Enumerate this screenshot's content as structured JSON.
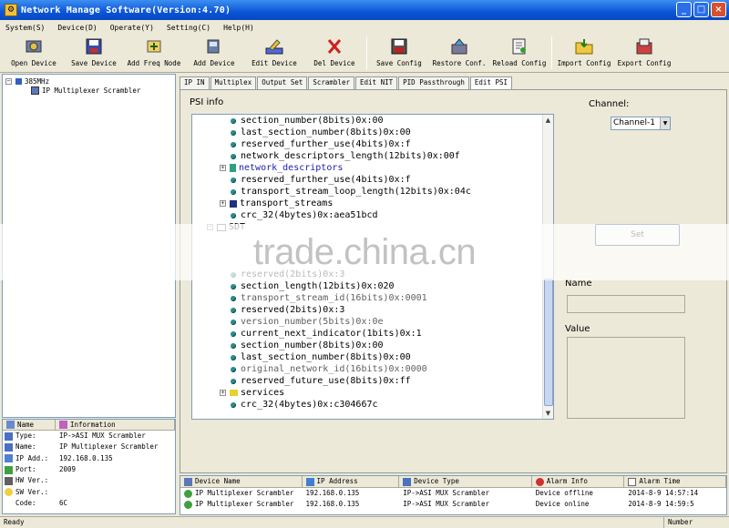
{
  "window": {
    "title": "Network Manage Software(Version:4.70)"
  },
  "menu": [
    "System(S)",
    "Device(D)",
    "Operate(Y)",
    "Setting(C)",
    "Help(H)"
  ],
  "toolbar": {
    "open_device": "Open Device",
    "save_device": "Save Device",
    "add_freq_node": "Add Freq Node",
    "add_device": "Add Device",
    "edit_device": "Edit Device",
    "del_device": "Del Device",
    "save_config": "Save Config",
    "restore_conf": "Restore Conf.",
    "reload_config": "Reload Config",
    "import_config": "Import Config",
    "export_config": "Export Config"
  },
  "left_tree": {
    "root": "385MHz",
    "child": "IP Multiplexer Scrambler"
  },
  "info": {
    "col_name": "Name",
    "col_info": "Information",
    "rows": [
      {
        "key": "Type:",
        "value": "IP->ASI MUX Scrambler"
      },
      {
        "key": "Name:",
        "value": "IP Multiplexer Scrambler"
      },
      {
        "key": "IP Add.:",
        "value": "192.168.0.135"
      },
      {
        "key": "Port:",
        "value": "2009"
      },
      {
        "key": "HW Ver.:",
        "value": ""
      },
      {
        "key": "SW Ver.:",
        "value": ""
      },
      {
        "key": "Code:",
        "value": "6C"
      }
    ]
  },
  "tabs": [
    "IP IN",
    "Multiplex",
    "Output Set",
    "Scrambler",
    "Edit NIT",
    "PID Passthrough",
    "Edit PSI"
  ],
  "psi": {
    "label": "PSI info",
    "lines": [
      "section_number(8bits)0x:00",
      "last_section_number(8bits)0x:00",
      "reserved_further_use(4bits)0x:f",
      "network_descriptors_length(12bits)0x:00f",
      "network_descriptors",
      "reserved_further_use(4bits)0x:f",
      "transport_stream_loop_length(12bits)0x:04c",
      "transport_streams",
      "crc_32(4bytes)0x:aea51bcd",
      "SDT",
      "reserved(2bits)0x:3",
      "section_length(12bits)0x:020",
      "transport_stream_id(16bits)0x:0001",
      "reserved(2bits)0x:3",
      "version_number(5bits)0x:0e",
      "current_next_indicator(1bits)0x:1",
      "section_number(8bits)0x:00",
      "last_section_number(8bits)0x:00",
      "original_network_id(16bits)0x:0000",
      "reserved_future_use(8bits)0x:ff",
      "services",
      "crc_32(4bytes)0x:c304667c"
    ]
  },
  "right": {
    "channel_label": "Channel:",
    "channel_value": "Channel-1",
    "set_label": "Set",
    "name_label": "Name",
    "value_label": "Value"
  },
  "watermark": "trade.china.cn",
  "device_list": {
    "headers": [
      "Device Name",
      "IP Address",
      "Device Type",
      "Alarm Info",
      "Alarm Time"
    ],
    "rows": [
      [
        "IP Multiplexer Scrambler",
        "192.168.0.135",
        "IP->ASI MUX Scrambler",
        "Device offline",
        "2014-8-9 14:57:14"
      ],
      [
        "IP Multiplexer Scrambler",
        "192.168.0.135",
        "IP->ASI MUX Scrambler",
        "Device online",
        "2014-8-9 14:59:5"
      ]
    ]
  },
  "status": {
    "text": "Ready",
    "num": "Number"
  }
}
